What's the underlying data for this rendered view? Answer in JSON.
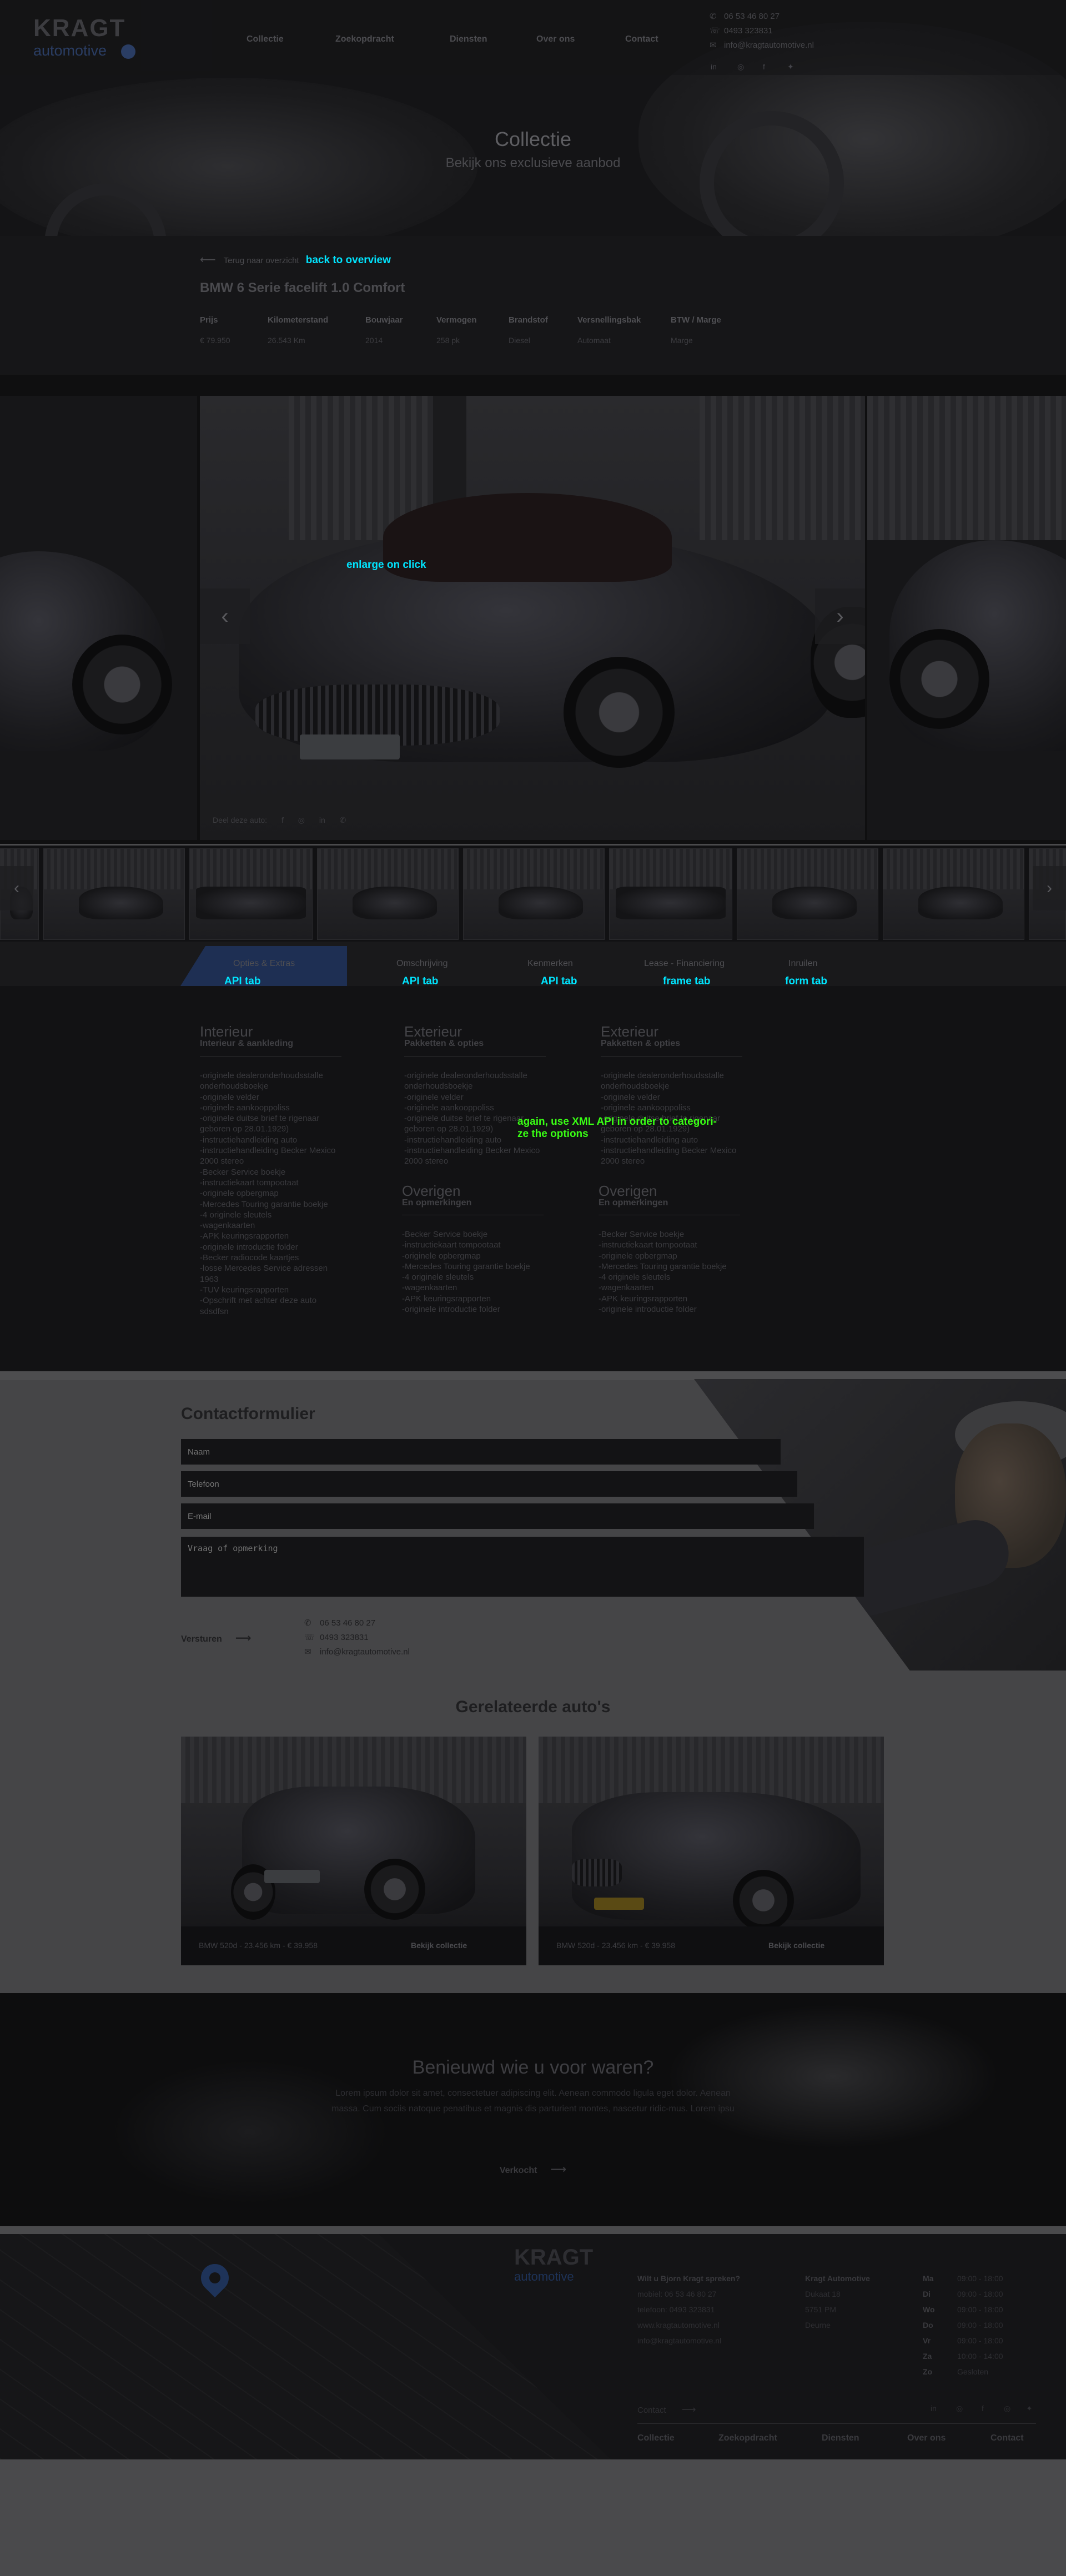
{
  "header": {
    "logo_main": "KRAGT",
    "logo_sub": "automotive",
    "nav": [
      "Collectie",
      "Zoekopdracht",
      "Diensten",
      "Over ons",
      "Contact"
    ],
    "phone1": "06 53 46 80 27",
    "phone2": "0493 323831",
    "email": "info@kragtautomotive.nl",
    "social_icons": [
      "linkedin-icon",
      "instagram-icon",
      "facebook-icon",
      "twitter-icon"
    ]
  },
  "hero": {
    "title": "Collectie",
    "subtitle": "Bekijk ons exclusieve aanbod"
  },
  "detail": {
    "back_text": "Terug naar overzicht",
    "back_overlay": "back to overview",
    "title": "BMW 6 Serie facelift 1.0 Comfort",
    "specs": [
      {
        "key": "Prijs",
        "value": "€ 79.950"
      },
      {
        "key": "Kilometerstand",
        "value": "26.543 Km"
      },
      {
        "key": "Bouwjaar",
        "value": "2014"
      },
      {
        "key": "Vermogen",
        "value": "258 pk"
      },
      {
        "key": "Brandstof",
        "value": "Diesel"
      },
      {
        "key": "Versnellingsbak",
        "value": "Automaat"
      },
      {
        "key": "BTW / Marge",
        "value": "Marge"
      }
    ]
  },
  "gallery": {
    "enlarge_overlay": "enlarge on click",
    "share_label": "Deel deze auto:",
    "share_icons": [
      "facebook-icon",
      "instagram-icon",
      "linkedin-icon",
      "whatsapp-icon"
    ],
    "prev_glyph": "‹",
    "next_glyph": "›"
  },
  "tabs": [
    {
      "label": "Opties & Extras",
      "overlay": "API tab"
    },
    {
      "label": "Omschrijving",
      "overlay": "API tab"
    },
    {
      "label": "Kenmerken",
      "overlay": "API tab"
    },
    {
      "label": "Lease - Financiering",
      "overlay": "frame tab"
    },
    {
      "label": "Inruilen",
      "overlay": "form tab"
    }
  ],
  "options": {
    "xml_note_1": "again, use XML API in order to categori-",
    "xml_note_2": "ze the options",
    "col1": {
      "title": "Interieur",
      "sub": "Interieur & aankleding",
      "items": [
        "-originele dealeronderhoudsstalle",
        "onderhoudsboekje",
        "-originele velder",
        "-originele aankooppoliss",
        "-originele duitse brief te rigenaar",
        "geboren op 28.01.1929)",
        "-instructiehandleiding auto",
        "-instructiehandleiding Becker Mexico",
        "2000 stereo",
        "-Becker Service boekje",
        "-instructiekaart tompootaat",
        "-originele opbergmap",
        "-Mercedes Touring garantie boekje",
        "-4 originele sleutels",
        "-wagenkaarten",
        "-APK keuringsrapporten",
        "-originele introductie folder",
        "-Becker radiocode kaartjes",
        "-losse Mercedes Service adressen",
        "1963",
        "-TUV keuringsrapporten",
        "-Opschrift met achter deze auto",
        "sdsdfsn"
      ]
    },
    "col2": {
      "title": "Exterieur",
      "sub": "Pakketten & opties",
      "items": [
        "-originele dealeronderhoudsstalle",
        "onderhoudsboekje",
        "-originele velder",
        "-originele aankooppoliss",
        "-originele duitse brief te rigenaar",
        "geboren op 28.01.1929)",
        "-instructiehandleiding auto",
        "-instructiehandleiding Becker Mexico",
        "2000 stereo"
      ]
    },
    "col3": {
      "title": "Exterieur",
      "sub": "Pakketten & opties",
      "items": [
        "-originele dealeronderhoudsstalle",
        "onderhoudsboekje",
        "-originele velder",
        "-originele aankooppoliss",
        "-originele duitse brief te rigenaar",
        "geboren op 28.01.1929)",
        "-instructiehandleiding auto",
        "-instructiehandleiding Becker Mexico",
        "2000 stereo"
      ]
    },
    "col2b": {
      "title": "Overigen",
      "sub": "En opmerkingen",
      "items": [
        "-Becker Service boekje",
        "-instructiekaart tompootaat",
        "-originele opbergmap",
        "-Mercedes Touring garantie boekje",
        "-4 originele sleutels",
        "-wagenkaarten",
        "-APK keuringsrapporten",
        "-originele introductie folder"
      ]
    },
    "col3b": {
      "title": "Overigen",
      "sub": "En opmerkingen",
      "items": [
        "-Becker Service boekje",
        "-instructiekaart tompootaat",
        "-originele opbergmap",
        "-Mercedes Touring garantie boekje",
        "-4 originele sleutels",
        "-wagenkaarten",
        "-APK keuringsrapporten",
        "-originele introductie folder"
      ]
    }
  },
  "contact_form": {
    "title": "Contactformulier",
    "name_placeholder": "Naam",
    "phone_placeholder": "Telefoon",
    "email_placeholder": "E-mail",
    "message_placeholder": "Vraag of opmerking",
    "send_label": "Versturen",
    "phone1": "06 53 46 80 27",
    "phone2": "0493 323831",
    "email": "info@kragtautomotive.nl"
  },
  "related": {
    "title": "Gerelateerde auto's",
    "cards": [
      {
        "caption": "BMW 520d - 23.456 km - € 39.958",
        "link": "Bekijk collectie"
      },
      {
        "caption": "BMW 520d - 23.456 km - € 39.958",
        "link": "Bekijk collectie"
      }
    ]
  },
  "curious": {
    "title": "Benieuwd wie u voor waren?",
    "text": "Lorem ipsum dolor sit amet, consectetuer adipiscing elit. Aenean commodo ligula eget dolor. Aenean massa. Cum sociis natoque penatibus et magnis dis parturient montes, nascetur ridic-mus. Lorem ipsu",
    "link": "Verkocht"
  },
  "footer": {
    "logo_main": "KRAGT",
    "logo_sub": "automotive",
    "col1_title": "Wilt u Bjorn Kragt spreken?",
    "col1_lines": [
      "mobiel: 06 53 46 80 27",
      "telefoon: 0493 323831",
      "www.kragtautomotive.nl",
      "info@kragtautomotive.nl"
    ],
    "col2_title": "Kragt Automotive",
    "col2_lines": [
      "Dukaat 18",
      "5751 PM",
      "Deurne"
    ],
    "hours": [
      {
        "day": "Ma",
        "time": "09:00 - 18:00"
      },
      {
        "day": "Di",
        "time": "09:00 - 18:00"
      },
      {
        "day": "Wo",
        "time": "09:00 - 18:00"
      },
      {
        "day": "Do",
        "time": "09:00 - 18:00"
      },
      {
        "day": "Vr",
        "time": "09:00 - 18:00"
      },
      {
        "day": "Za",
        "time": "10:00 - 14:00"
      },
      {
        "day": "Zo",
        "time": "Gesloten"
      }
    ],
    "contact_label": "Contact",
    "social_icons": [
      "linkedin-icon",
      "instagram-icon",
      "facebook-icon",
      "instagram-icon",
      "twitter-icon"
    ],
    "nav": [
      "Collectie",
      "Zoekopdracht",
      "Diensten",
      "Over ons",
      "Contact"
    ]
  }
}
